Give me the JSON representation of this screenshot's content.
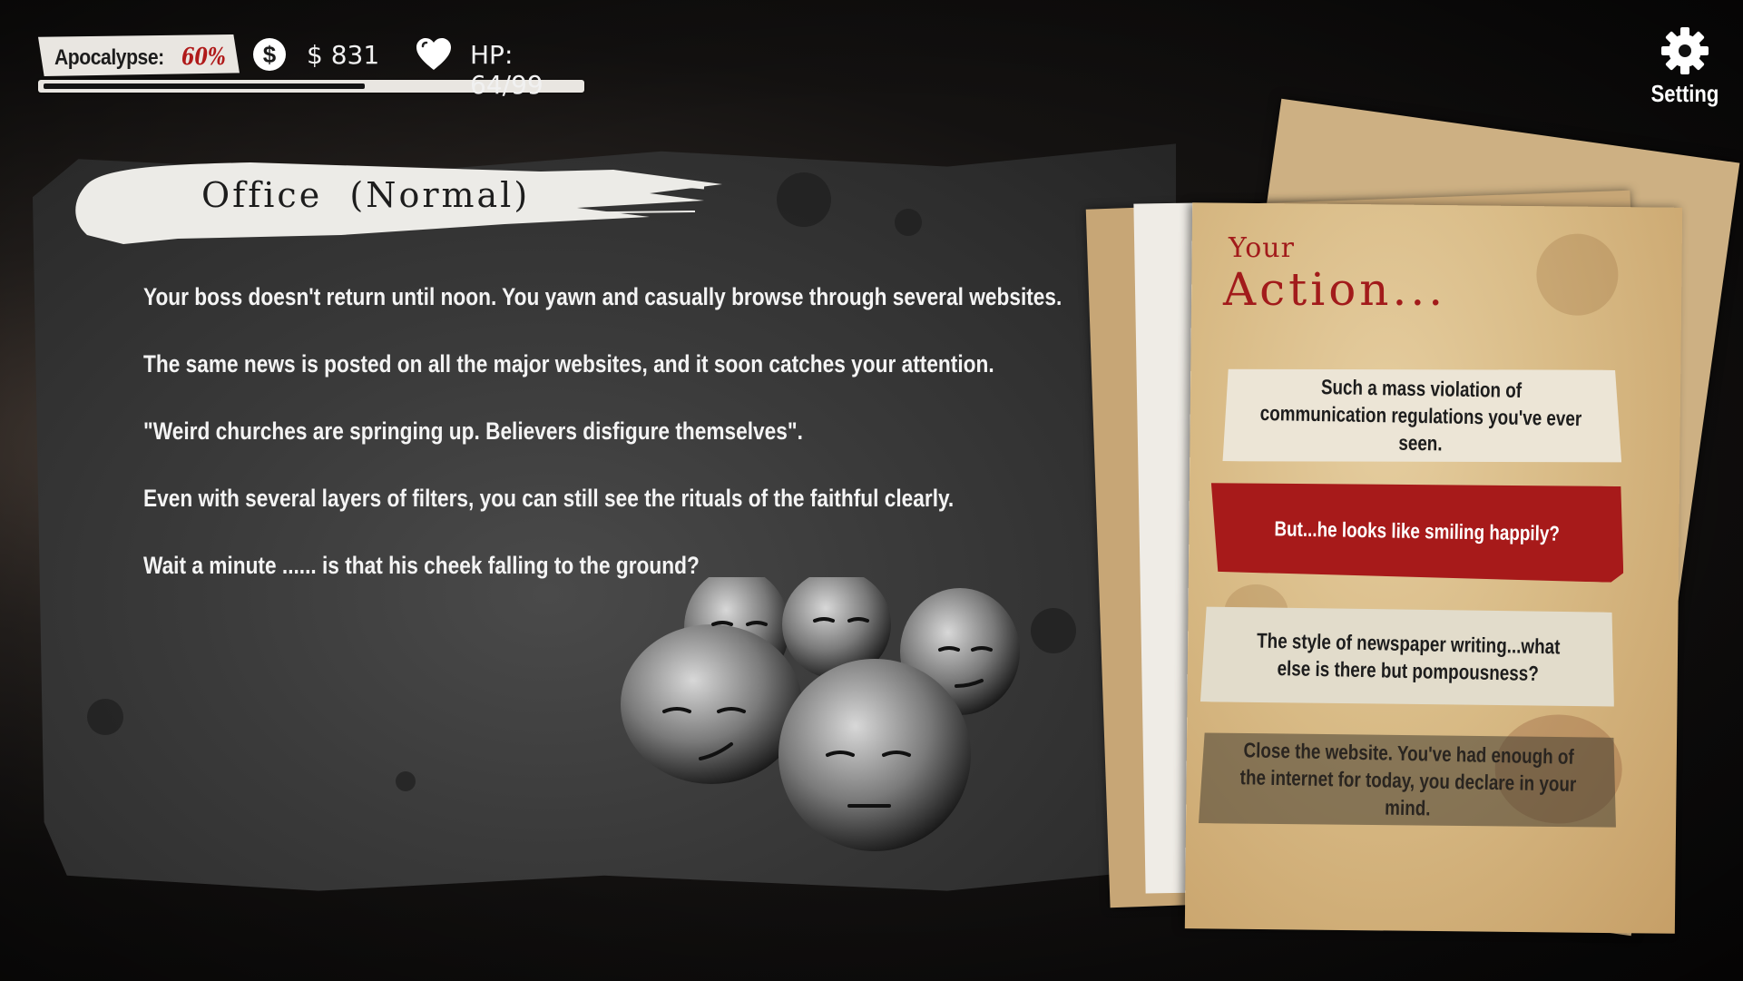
{
  "hud": {
    "apocalypse_label": "Apocalypse:",
    "apocalypse_percent": "60%",
    "apocalypse_progress": 0.6,
    "money_icon": "dollar-icon",
    "money": "$ 831",
    "hp_icon": "heart-icon",
    "hp": "HP: 64/99"
  },
  "settings": {
    "icon": "gear-icon",
    "label": "Setting"
  },
  "scene": {
    "title": "Office  (Normal)",
    "paragraphs": [
      "Your boss doesn't return until noon. You yawn and casually browse through several websites.",
      "The same news is posted on all the major websites, and it soon catches your attention.",
      "\"Weird churches are springing up. Believers disfigure themselves\".",
      "Even with several layers of filters, you can still see the rituals of the faithful clearly.",
      "Wait a minute ...... is that his cheek falling to the ground?"
    ]
  },
  "actions": {
    "heading_small": "Your",
    "heading_large": "Action...",
    "choices": [
      {
        "label": "Such a mass violation of communication regulations you've ever seen.",
        "state": "normal"
      },
      {
        "label": "But...he looks like smiling happily?",
        "state": "selected"
      },
      {
        "label": "The style of newspaper writing...what else is there but pompousness?",
        "state": "normal"
      },
      {
        "label": "Close the website. You've had enough of the internet for today, you declare in your mind.",
        "state": "dimmed"
      }
    ]
  },
  "colors": {
    "accent_red": "#a71a1a",
    "panel": "#333333",
    "paper": "#d8ba85"
  }
}
